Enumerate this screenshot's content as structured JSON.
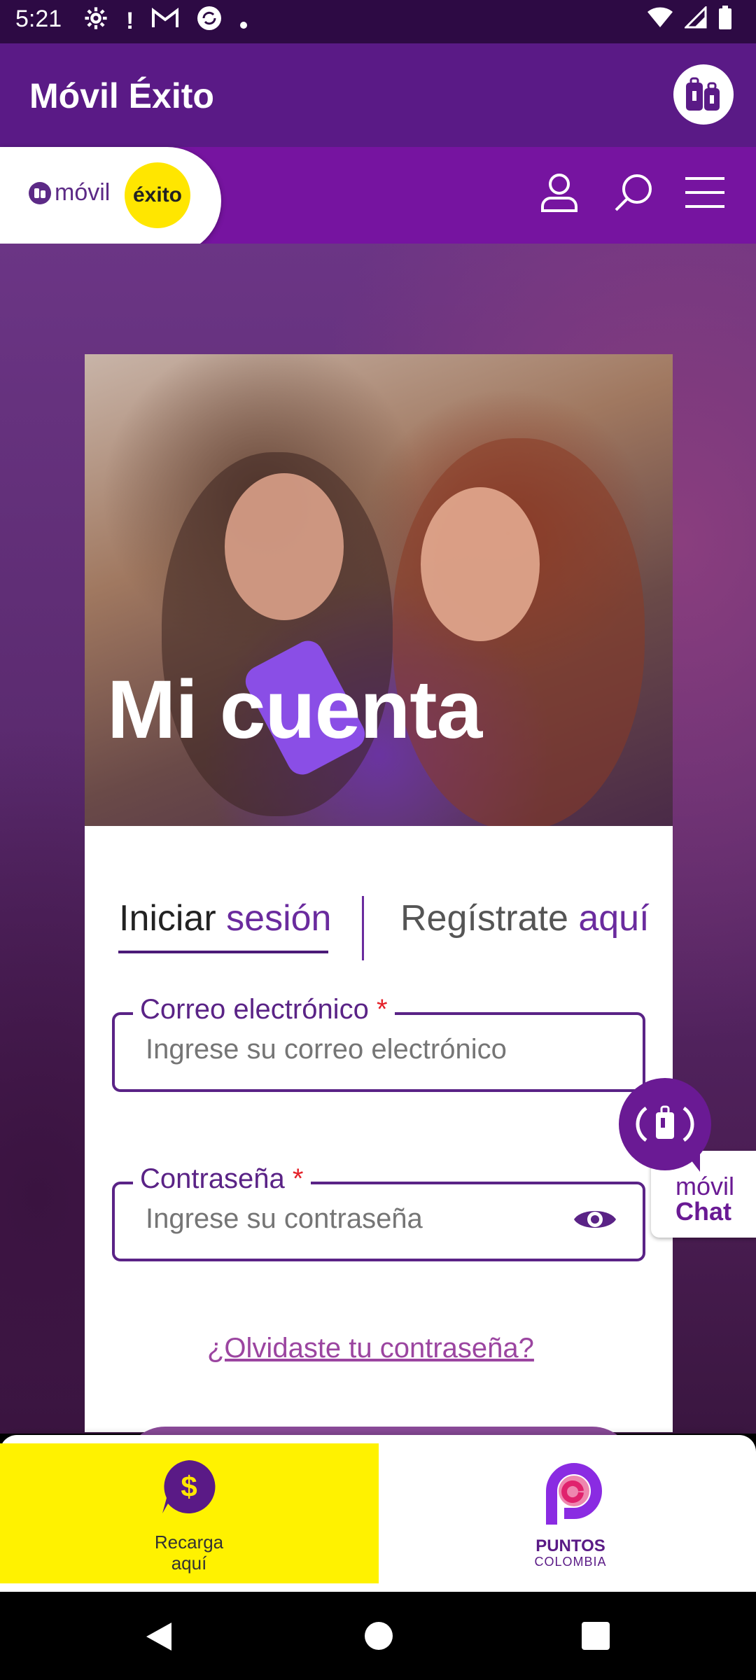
{
  "status_bar": {
    "time": "5:21",
    "left_icons": [
      "gear-icon",
      "alert-icon",
      "gmail-icon",
      "sync-icon",
      "dot-icon"
    ],
    "right_icons": [
      "wifi-icon",
      "signal-icon",
      "battery-icon"
    ]
  },
  "app_bar": {
    "title": "Móvil Éxito"
  },
  "header": {
    "logo_movil": "móvil",
    "logo_exito": "éxito",
    "icons": [
      "user-icon",
      "search-icon",
      "menu-icon"
    ]
  },
  "hero": {
    "title": "Mi cuenta"
  },
  "tabs": {
    "login_part1": "Iniciar ",
    "login_part2": "sesión",
    "register_part1": "Regístrate ",
    "register_part2": "aquí"
  },
  "form": {
    "email_label": "Correo electrónico",
    "email_required": "*",
    "email_placeholder": "Ingrese su correo electrónico",
    "password_label": "Contraseña",
    "password_required": "*",
    "password_placeholder": "Ingrese su contraseña",
    "forgot_link": "¿Olvidaste tu contraseña?"
  },
  "chat_widget": {
    "line1": "móvil",
    "line2": "Chat"
  },
  "bottom_bar": {
    "recarga_label_1": "Recarga",
    "recarga_label_2": "aquí",
    "puntos_label": "PUNTOS",
    "puntos_sub": "COLOMBIA"
  },
  "colors": {
    "primary": "#5a1a86",
    "accent": "#7614a0",
    "yellow": "#fff200"
  }
}
